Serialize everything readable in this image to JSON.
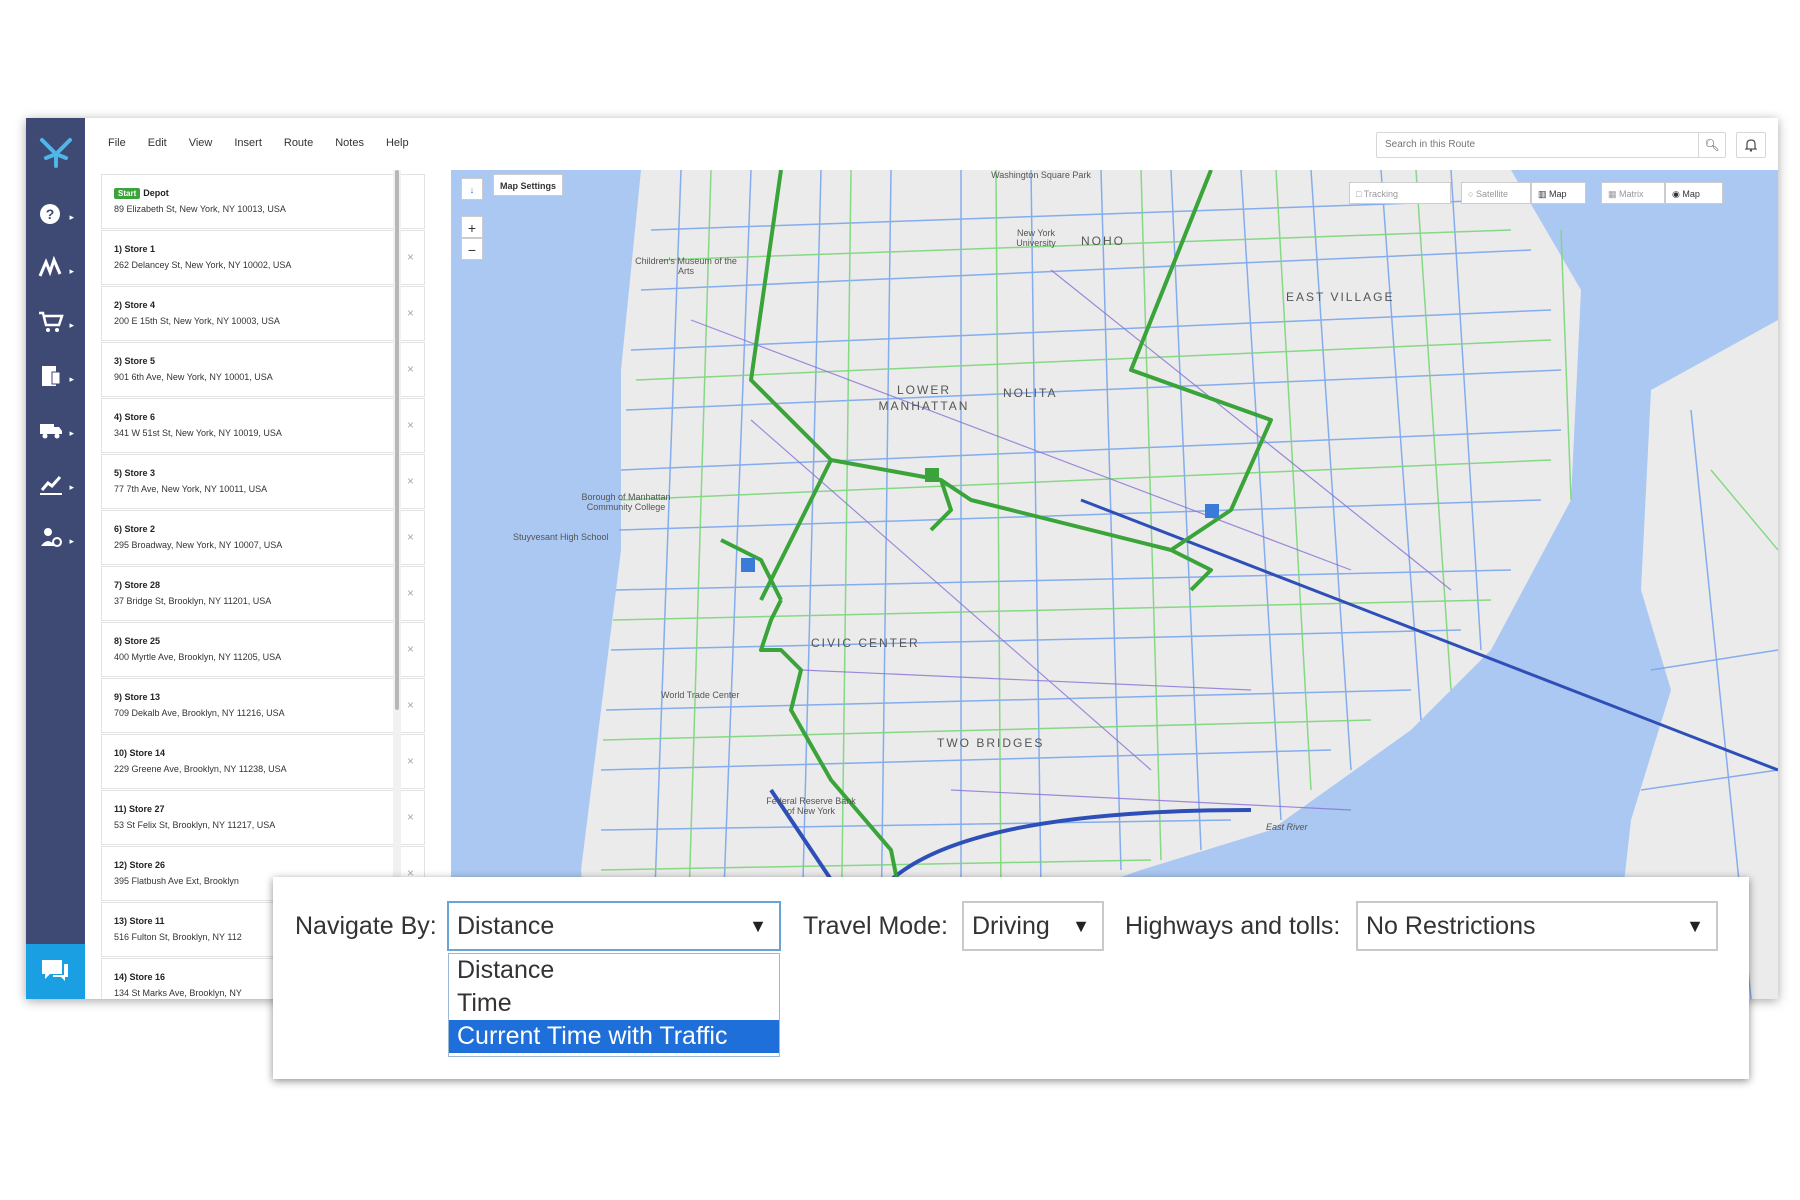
{
  "menu": [
    "File",
    "Edit",
    "View",
    "Insert",
    "Route",
    "Notes",
    "Help"
  ],
  "search": {
    "placeholder": "Search in this Route"
  },
  "stops": [
    {
      "badge": "Start",
      "name": "Depot",
      "address": "89 Elizabeth St, New York, NY 10013, USA"
    },
    {
      "name": "1) Store 1",
      "address": "262 Delancey St, New York, NY 10002, USA"
    },
    {
      "name": "2) Store 4",
      "address": "200 E 15th St, New York, NY 10003, USA"
    },
    {
      "name": "3) Store 5",
      "address": "901 6th Ave, New York, NY 10001, USA"
    },
    {
      "name": "4) Store 6",
      "address": "341 W 51st St, New York, NY 10019, USA"
    },
    {
      "name": "5) Store 3",
      "address": "77 7th Ave, New York, NY 10011, USA"
    },
    {
      "name": "6) Store 2",
      "address": "295 Broadway, New York, NY 10007, USA"
    },
    {
      "name": "7) Store 28",
      "address": "37 Bridge St, Brooklyn, NY 11201, USA"
    },
    {
      "name": "8) Store 25",
      "address": "400 Myrtle Ave, Brooklyn, NY 11205, USA"
    },
    {
      "name": "9) Store 13",
      "address": "709 Dekalb Ave, Brooklyn, NY 11216, USA"
    },
    {
      "name": "10) Store 14",
      "address": "229 Greene Ave, Brooklyn, NY 11238, USA"
    },
    {
      "name": "11) Store 27",
      "address": "53 St Felix St, Brooklyn, NY 11217, USA"
    },
    {
      "name": "12) Store 26",
      "address": "395 Flatbush Ave Ext, Brooklyn"
    },
    {
      "name": "13) Store 11",
      "address": "516 Fulton St, Brooklyn, NY 112"
    },
    {
      "name": "14) Store 16",
      "address": "134 St Marks Ave, Brooklyn, NY"
    }
  ],
  "map": {
    "settings_label": "Map Settings",
    "tracking_label": "Tracking",
    "satellite_label": "Satellite",
    "map_label": "Map",
    "matrix_label": "Matrix",
    "map2_label": "Map",
    "zoom_in": "+",
    "zoom_out": "−",
    "place_labels": [
      "Washington Square Park",
      "New York University",
      "NOHO",
      "EAST VILLAGE",
      "LOWER MANHATTAN",
      "NOLITA",
      "Children's Museum of the Arts",
      "Borough of Manhattan Community College",
      "Stuyvesant High School",
      "CIVIC CENTER",
      "TWO BRIDGES",
      "Federal Reserve Bank of New York",
      "World Trade Center",
      "East River"
    ]
  },
  "options_panel": {
    "navigate_by_label": "Navigate By:",
    "navigate_by_value": "Distance",
    "navigate_by_options": [
      "Distance",
      "Time",
      "Current Time with Traffic"
    ],
    "navigate_by_highlighted": "Current Time with Traffic",
    "travel_mode_label": "Travel Mode:",
    "travel_mode_value": "Driving",
    "highways_label": "Highways and tolls:",
    "highways_value": "No Restrictions"
  },
  "colors": {
    "sidebar": "#3f4a74",
    "accent": "#1aa0e2",
    "route": "#3aa43a",
    "water": "#aac8f2",
    "highlight": "#1e6fd9"
  }
}
